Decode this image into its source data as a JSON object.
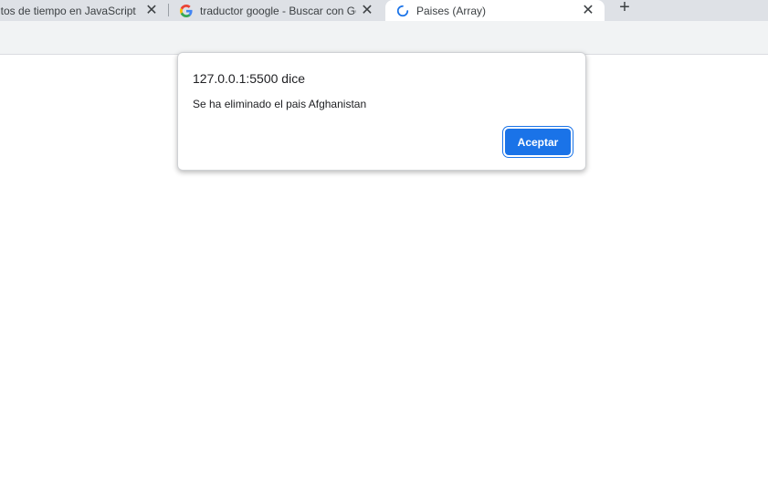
{
  "tabs": [
    {
      "label": "ntos de tiempo en JavaScript",
      "close": "✕",
      "favicon": "none"
    },
    {
      "label": "traductor google - Buscar con Google",
      "close": "✕",
      "favicon": "google-g-icon"
    },
    {
      "label": "Paises (Array)",
      "close": "✕",
      "favicon": "loading-spinner-icon",
      "active": true
    }
  ],
  "new_tab_label": "+",
  "dialog": {
    "title": "127.0.0.1:5500 dice",
    "message": "Se ha eliminado el pais Afghanistan",
    "ok_label": "Aceptar"
  },
  "colors": {
    "accent": "#1a73e8",
    "tabstrip": "#dee1e6",
    "toolbar": "#f1f3f4"
  }
}
